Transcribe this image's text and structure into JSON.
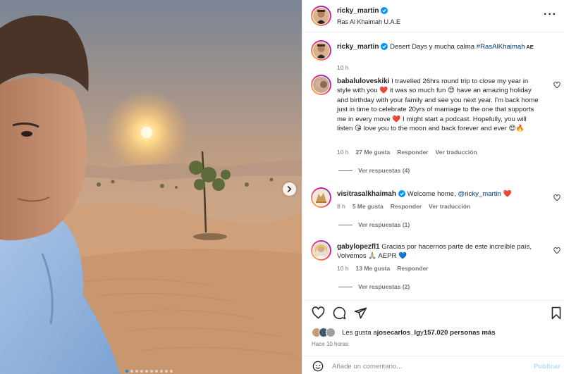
{
  "post": {
    "author": "ricky_martin",
    "location": "Ras Al Khaimah U.A.E",
    "more_label": "···",
    "caption": {
      "username": "ricky_martin",
      "text": "Desert Days y mucha calma ",
      "hashtag": "#RasAlKhaimah",
      "flag": " AE",
      "time": "10 h"
    }
  },
  "comments": [
    {
      "username": "babaluloveskiki",
      "text": "I travelled 26hrs round trip to close my year in style with you ❤️ it was so much fun 😍 have an amazing holiday and birthday with your family and see you next year. I'm back home just in time to celebrate 20yrs of marriage to the one that supports me in every move ❤️ I might start a podcast. Hopefully, you will listen 😘 love you to the moon and back forever and ever 😍🔥",
      "time": "10 h",
      "likes": "27 Me gusta",
      "reply": "Responder",
      "translate": "Ver traducción",
      "replies": "Ver respuestas (4)"
    },
    {
      "username": "visitrasalkhaimah",
      "text": "Welcome home, ",
      "mention": "@ricky_martin",
      "emoji": " ❤️",
      "time": "8 h",
      "likes": "5 Me gusta",
      "reply": "Responder",
      "translate": "Ver traducción",
      "replies": "Ver respuestas (1)"
    },
    {
      "username": "gabylopezfl1",
      "text": "Gracias por hacernos parte de este increíble país, Volvemos 🙏🏼 AEPR 💙",
      "time": "10 h",
      "likes": "13 Me gusta",
      "reply": "Responder",
      "replies": "Ver respuestas (2)"
    }
  ],
  "likes_line": {
    "prefix": "Les gusta a ",
    "user": "josecarlos_lg",
    "middle": " y ",
    "count": "157.020 personas más"
  },
  "posted_ago": "Hace 10 horas",
  "add_comment": {
    "placeholder": "Añade un comentario...",
    "post_label": "Publicar"
  },
  "carousel": {
    "total": 10,
    "current": 0
  },
  "colors": {
    "link": "#00376b",
    "accent": "#0095f6",
    "verified": "#0095f6",
    "heart": "#ed4956"
  },
  "icons": [
    "verified-badge-icon",
    "more-options-icon",
    "heart-icon",
    "comment-icon",
    "share-icon",
    "bookmark-icon",
    "emoji-icon",
    "next-arrow-icon"
  ]
}
